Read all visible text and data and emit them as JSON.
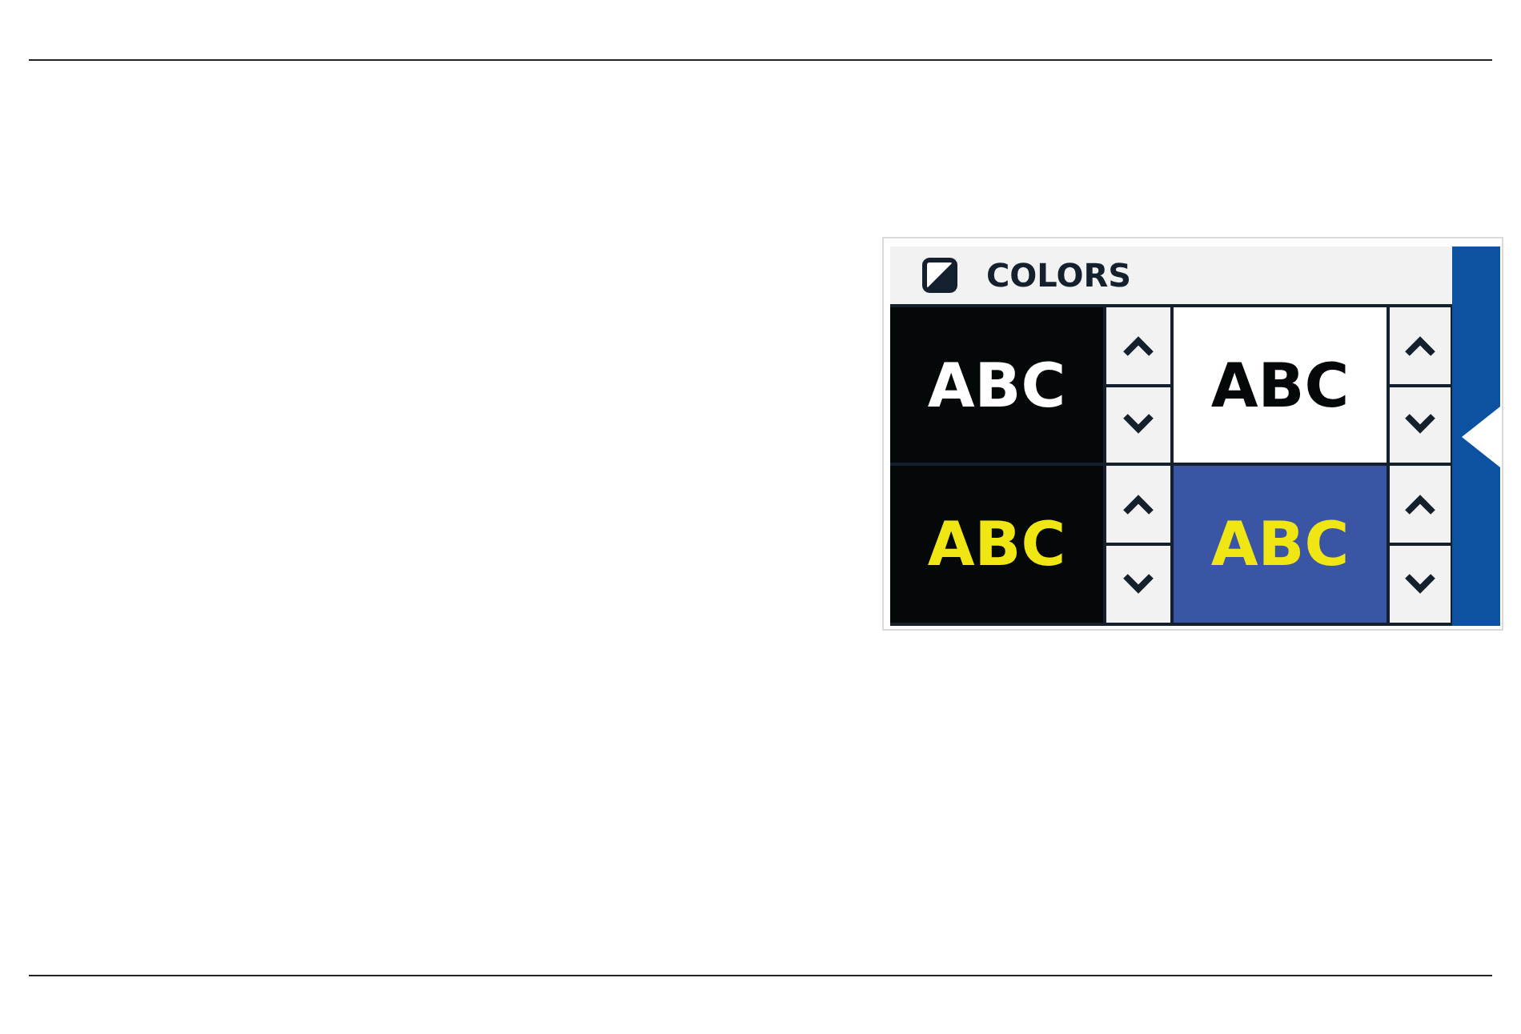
{
  "panel": {
    "title": "COLORS"
  },
  "swatches": [
    {
      "color": "#050808",
      "label": {
        "text": "ABC",
        "color": "#ffffff"
      }
    },
    {
      "color": "#ffffff",
      "label": {
        "text": "ABC",
        "color": "#050808"
      }
    },
    {
      "color": "#050808",
      "label": {
        "text": "ABC",
        "color": "#f0e614"
      }
    },
    {
      "color": "#3a55a4",
      "label": {
        "text": "ABC",
        "color": "#f0e614"
      }
    }
  ]
}
